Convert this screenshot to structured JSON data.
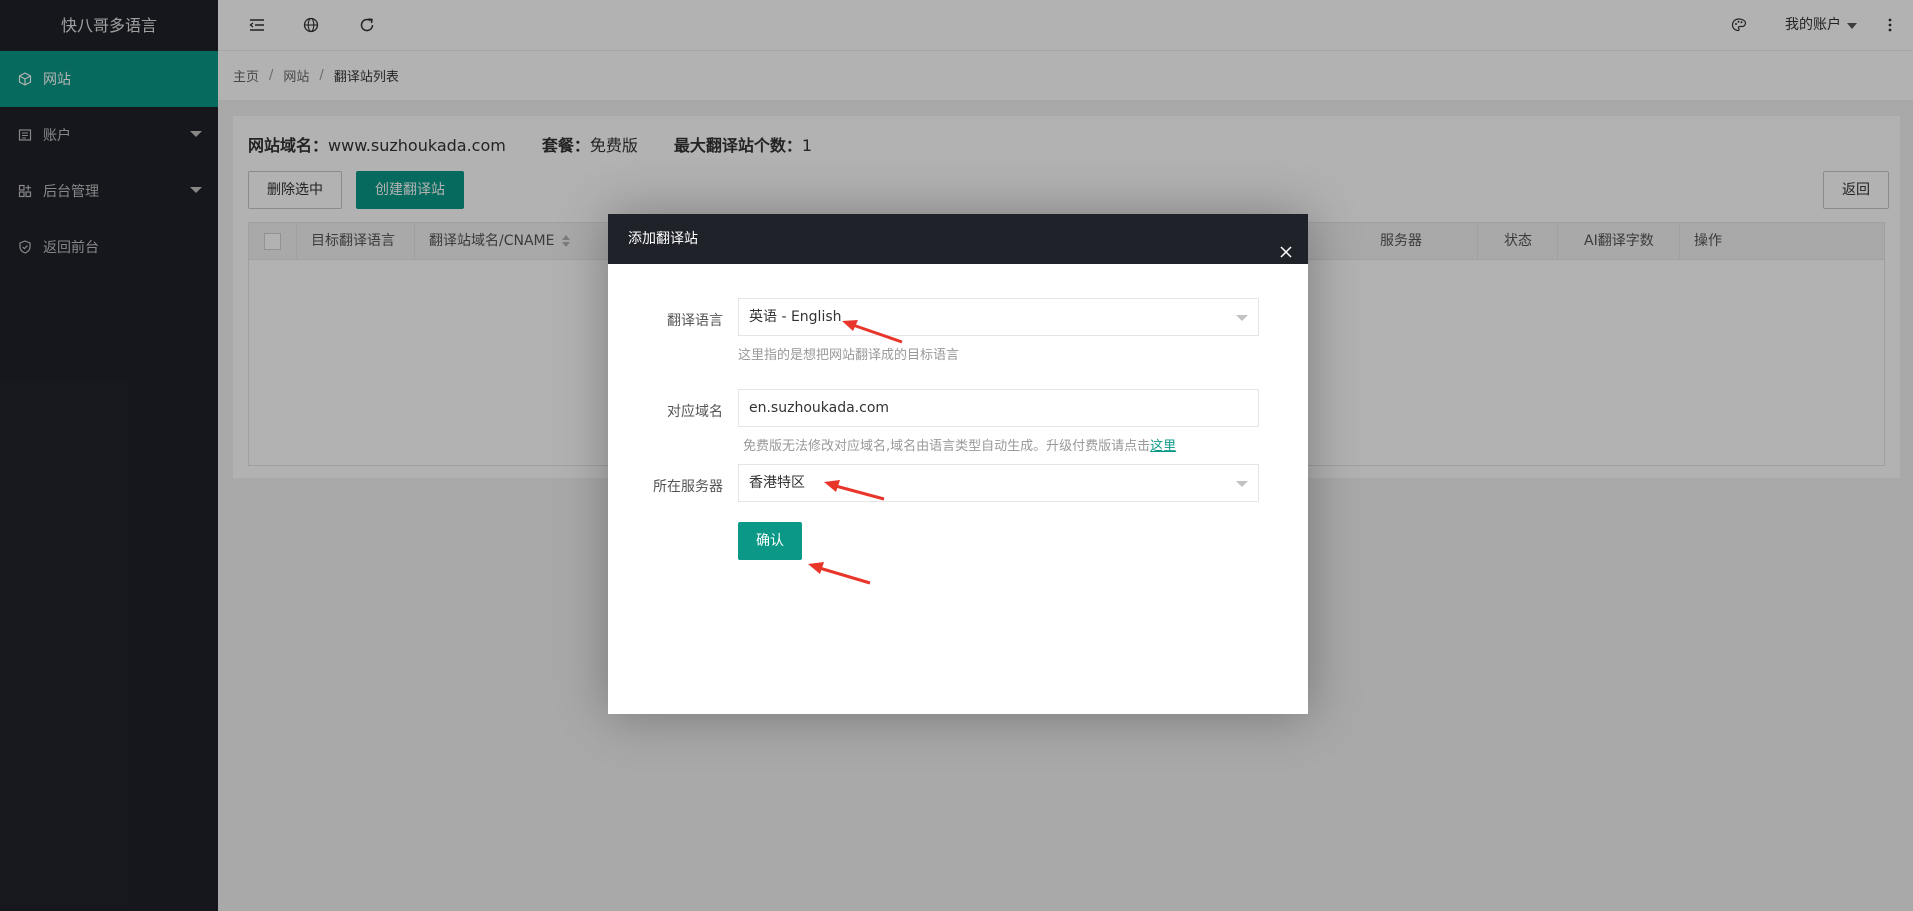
{
  "app": {
    "logo": "快八哥多语言"
  },
  "sidebar": {
    "items": [
      {
        "label": "网站",
        "icon": "cube-icon",
        "active": true,
        "has_caret": false
      },
      {
        "label": "账户",
        "icon": "id-card-icon",
        "active": false,
        "has_caret": true
      },
      {
        "label": "后台管理",
        "icon": "app-grid-icon",
        "active": false,
        "has_caret": true
      },
      {
        "label": "返回前台",
        "icon": "shield-icon",
        "active": false,
        "has_caret": false
      }
    ]
  },
  "header": {
    "icons": [
      "menu-collapse-icon",
      "globe-icon",
      "refresh-icon"
    ],
    "right_icons": [
      "palette-icon",
      "more-vertical-icon"
    ],
    "account_label": "我的账户"
  },
  "breadcrumb": {
    "items": [
      "主页",
      "网站",
      "翻译站列表"
    ]
  },
  "site_info": {
    "domain_label": "网站域名：",
    "domain_value": "www.suzhoukada.com",
    "plan_label": "套餐：",
    "plan_value": "免费版",
    "max_label": "最大翻译站个数：",
    "max_value": "1"
  },
  "toolbar": {
    "delete_label": "删除选中",
    "create_label": "创建翻译站",
    "back_label": "返回"
  },
  "table": {
    "columns": [
      "目标翻译语言",
      "翻译站域名/CNAME",
      "服务器",
      "状态",
      "AI翻译字数",
      "操作"
    ]
  },
  "modal": {
    "title": "添加翻译站",
    "language_label": "翻译语言",
    "language_value": "英语 - English",
    "language_hint": "这里指的是想把网站翻译成的目标语言",
    "domain_label": "对应域名",
    "domain_value": "en.suzhoukada.com",
    "domain_hint": "免费版无法修改对应域名,域名由语言类型自动生成。升级付费版请点击",
    "domain_hint_link": "这里",
    "server_label": "所在服务器",
    "server_value": "香港特区",
    "confirm_label": "确认"
  },
  "colors": {
    "sidebar_bg": "#20222a",
    "accent": "#0b9887",
    "annotation_arrow": "#e8362b"
  }
}
